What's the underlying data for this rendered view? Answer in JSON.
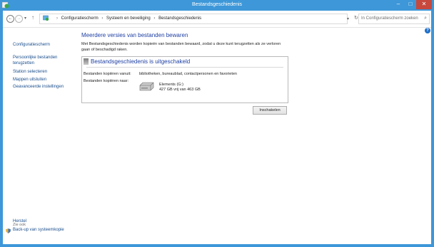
{
  "window": {
    "title": "Bestandsgeschiedenis",
    "controls": {
      "minimize": "–",
      "maximize": "□",
      "close": "✕"
    }
  },
  "addressbar": {
    "back": "←",
    "forward": "→",
    "recent": "▾",
    "up": "↑",
    "breadcrumbs": [
      "Configuratiescherm",
      "Systeem en beveiliging",
      "Bestandsgeschiedenis"
    ],
    "separator": "›",
    "dropdown": "▾",
    "refresh": "↻",
    "search_placeholder": "In Configuratiescherm zoeken",
    "search_icon": "⌕"
  },
  "help": "?",
  "sidebar": {
    "links": [
      "Configuratiescherm",
      "Persoonlijke bestanden terugzetten",
      "Station selecteren",
      "Mappen uitsluiten",
      "Geavanceerde instellingen"
    ],
    "see_also_title": "Zie ook",
    "see_also": [
      "Herstel",
      "Back-up van systeemkopie"
    ]
  },
  "main": {
    "heading": "Meerdere versies van bestanden bewaren",
    "description": "Met Bestandsgeschiedenis worden kopieën van bestanden bewaard, zodat u deze kunt terugzetten als ze verloren gaan of beschadigd raken.",
    "status_title": "Bestandsgeschiedenis is uitgeschakeld",
    "copy_from_label": "Bestanden kopiëren vanuit:",
    "copy_from_value": "bibliotheken, bureaublad, contactpersonen en favorieten",
    "copy_to_label": "Bestanden kopiëren naar:",
    "drive_name": "Elements (G:)",
    "drive_space": "427 GB vrij van 463 GB",
    "enable_button": "Inschakelen"
  }
}
